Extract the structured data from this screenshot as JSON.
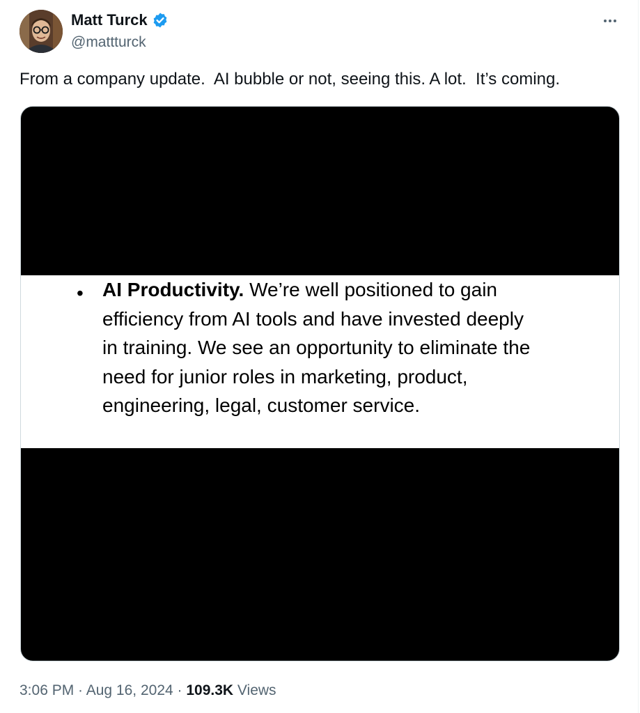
{
  "author": {
    "name": "Matt Turck",
    "handle": "@mattturck",
    "verified": true
  },
  "tweet": {
    "text": "From a company update.  AI bubble or not, seeing this. A lot.  It’s coming."
  },
  "media": {
    "bullet": "•",
    "bold_lead": "AI Productivity.",
    "line1_rest": " We’re well positioned to gain",
    "line2": "efficiency from AI tools and have invested deeply",
    "line3": "in training. We see an opportunity to eliminate the",
    "line4": "need for junior roles in marketing, product,",
    "line5": "engineering, legal, customer service."
  },
  "meta": {
    "time": "3:06 PM",
    "separator1": " · ",
    "date": "Aug 16, 2024",
    "separator2": " · ",
    "views_count": "109.3K",
    "views_label": " Views"
  },
  "icons": {
    "verified": "verified-badge-icon",
    "more": "more-horizontal-icon"
  },
  "colors": {
    "verified_blue": "#1d9bf0",
    "text_primary": "#0f1419",
    "text_secondary": "#536471",
    "border": "#cfd9de"
  }
}
